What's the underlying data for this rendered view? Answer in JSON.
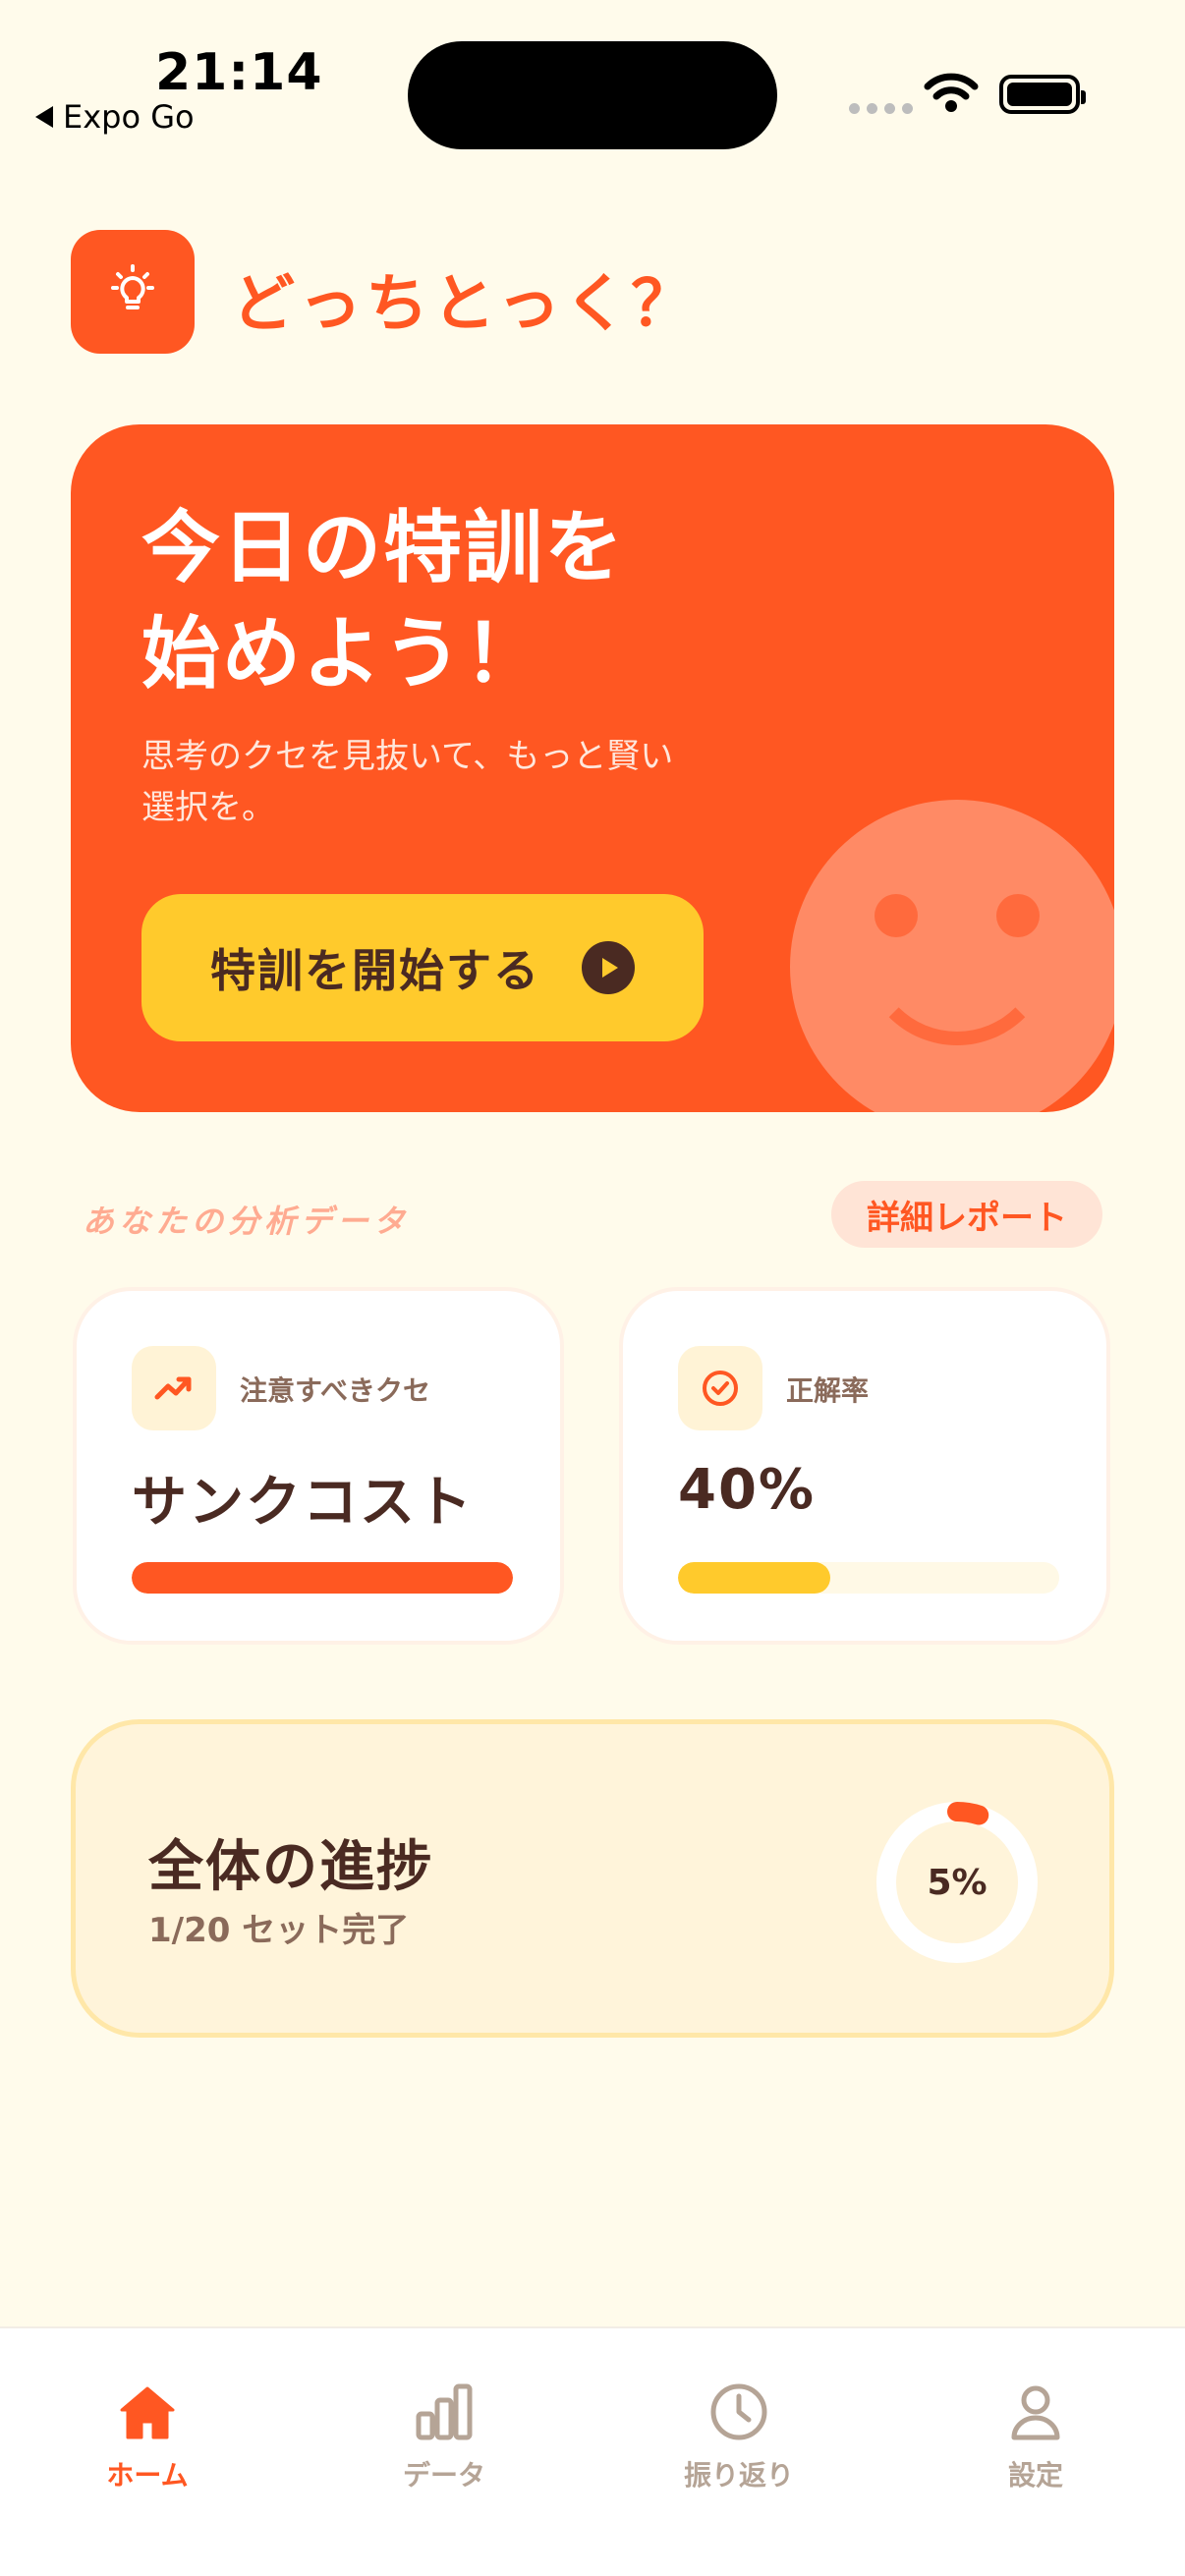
{
  "status_bar": {
    "time": "21:14",
    "back_label": "Expo Go",
    "icons": [
      "signal-dots-icon",
      "wifi-icon",
      "battery-icon"
    ]
  },
  "header": {
    "logo_icon": "lightbulb-icon",
    "title": "どっちとっく？"
  },
  "hero": {
    "title_lines": [
      "今日の特訓を",
      "始めよう！"
    ],
    "subtitle_lines": [
      "思考のクセを見抜いて、もっと賢い",
      "選択を。"
    ],
    "button_label": "特訓を開始する",
    "button_icon": "play-icon",
    "decoration_icon": "smiley-icon"
  },
  "analysis": {
    "section_label": "あなたの分析データ",
    "report_button": "詳細レポート",
    "cards": [
      {
        "icon": "trending-up-icon",
        "label": "注意すべきクセ",
        "value": "サンクコスト",
        "bar_fraction": 1.0,
        "bar_color": "#FF5722"
      },
      {
        "icon": "check-circle-icon",
        "label": "正解率",
        "value": "40%",
        "bar_fraction": 0.4,
        "bar_color": "#FFCA2C"
      }
    ]
  },
  "progress": {
    "title": "全体の進捗",
    "subtitle": "1/20 セット完了",
    "percent_label": "5%",
    "fraction": 0.05
  },
  "tabs": [
    {
      "label": "ホーム",
      "icon": "home-icon",
      "active": true
    },
    {
      "label": "データ",
      "icon": "bar-chart-icon",
      "active": false
    },
    {
      "label": "振り返り",
      "icon": "clock-icon",
      "active": false
    },
    {
      "label": "設定",
      "icon": "person-icon",
      "active": false
    }
  ],
  "colors": {
    "background": "#FFFBEB",
    "accent": "#FF5722",
    "yellow": "#FFCA2C",
    "text_dark": "#4A2A22",
    "tab_inactive": "#B5A496"
  }
}
